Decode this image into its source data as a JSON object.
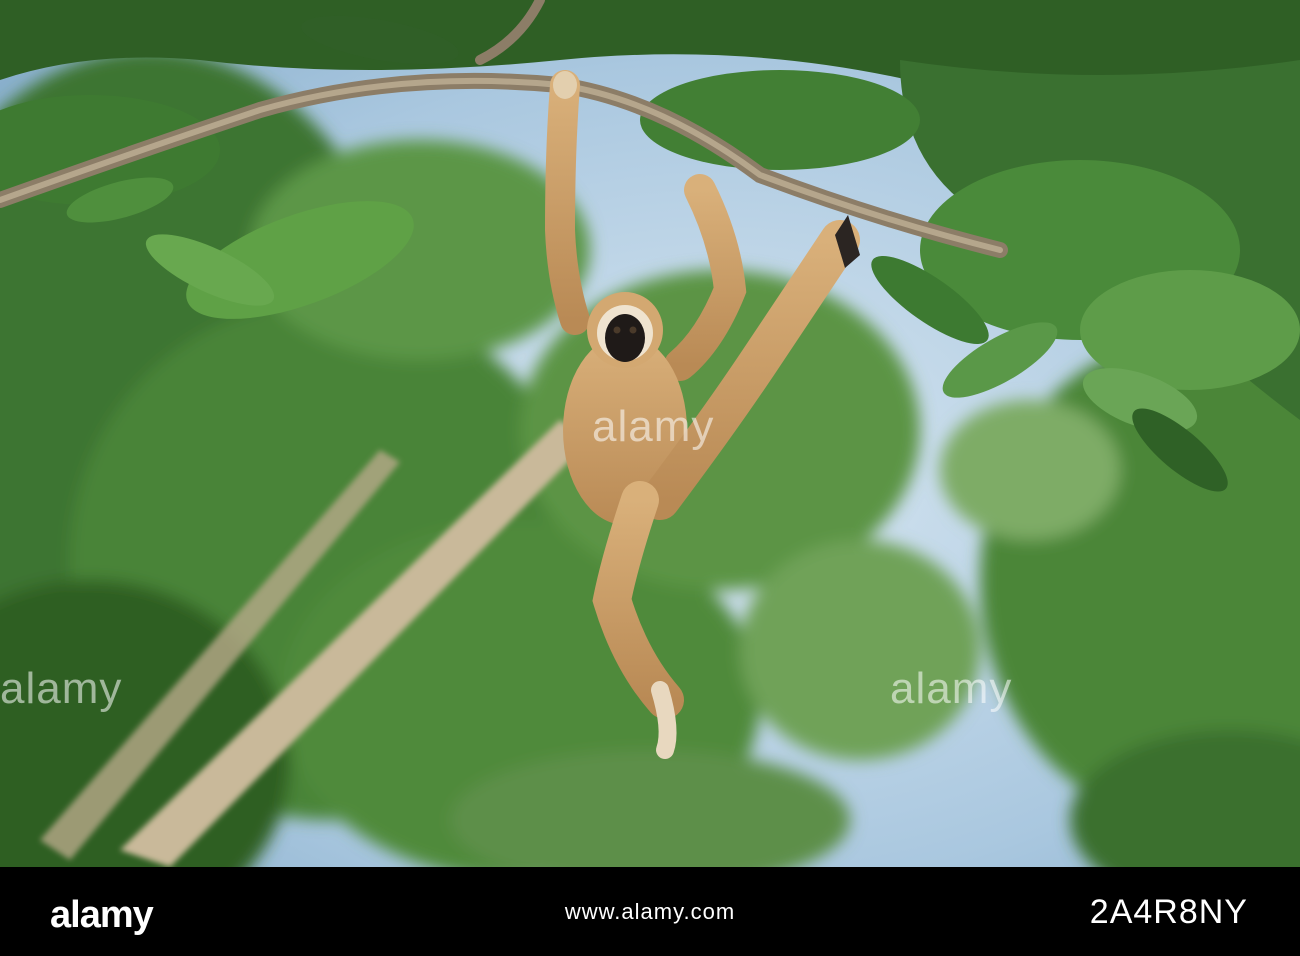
{
  "photo": {
    "subject": "gibbon",
    "colors": {
      "sky": "#a9c7df",
      "foliage": "#3f7a2e",
      "fur": "#c79a63",
      "branch": "#8a7a63"
    }
  },
  "watermarks": {
    "left": "alamy",
    "center": "alamy",
    "right": "alamy"
  },
  "footer": {
    "logo_text": "alamy",
    "image_id": "2A4R8NY",
    "url": "www.alamy.com",
    "background": "#000000"
  }
}
